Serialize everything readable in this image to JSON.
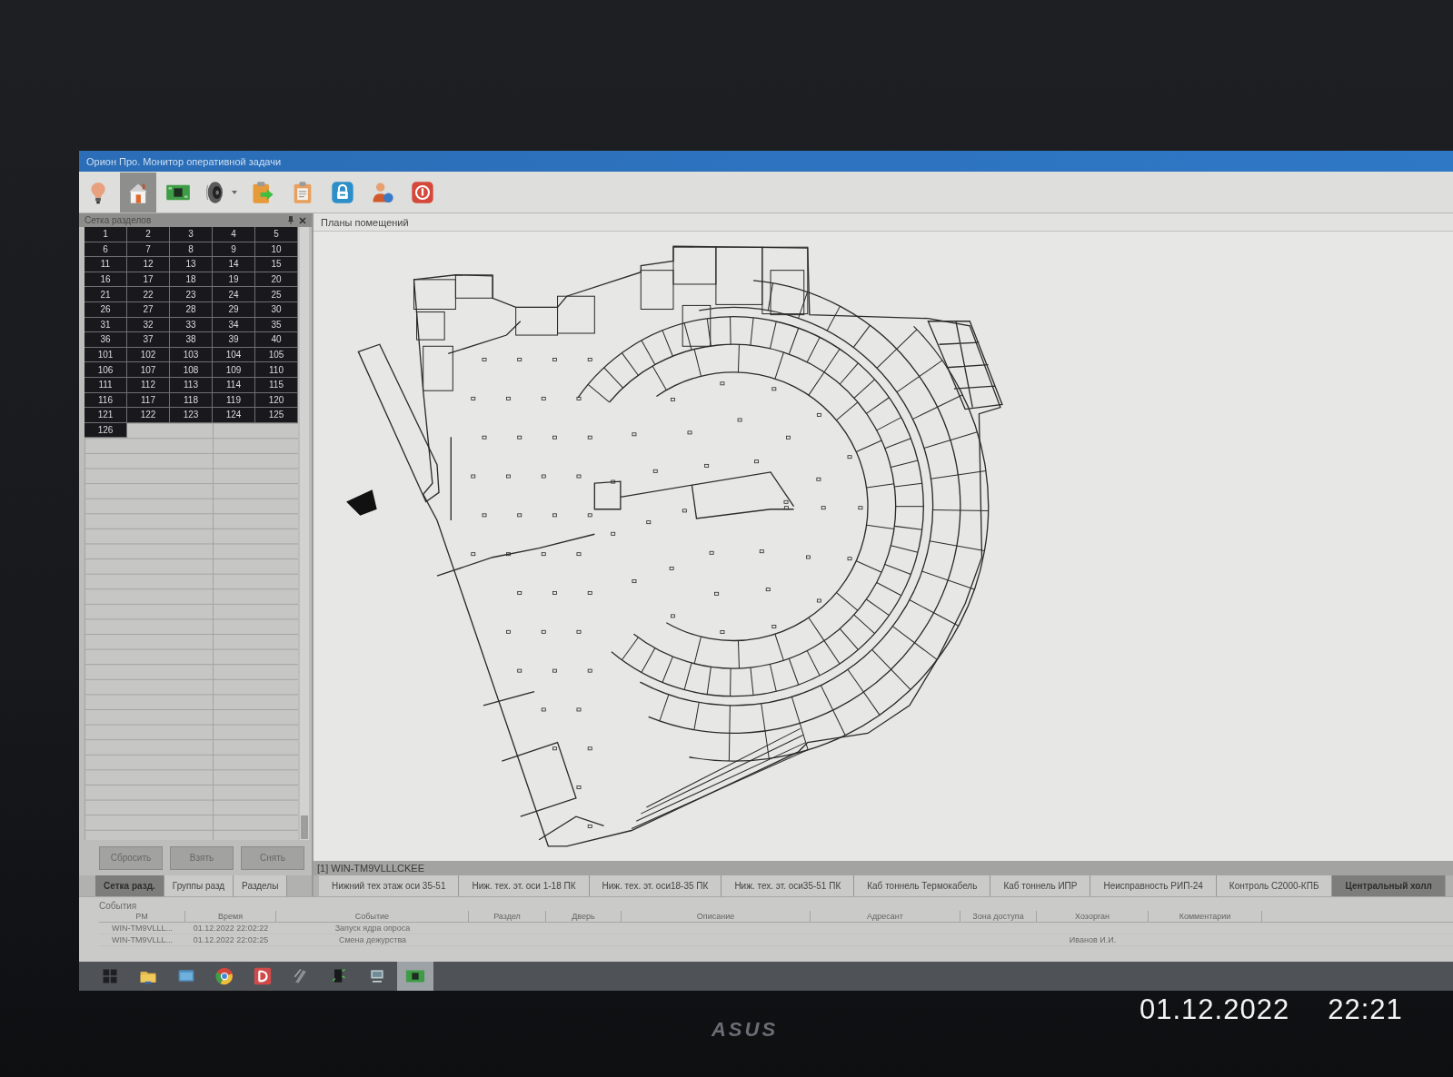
{
  "window": {
    "title": "Орион Про. Монитор оперативной задачи"
  },
  "toolbar": {
    "buttons": [
      {
        "selected": false,
        "dropdown": false
      },
      {
        "selected": true,
        "dropdown": false
      },
      {
        "selected": false,
        "dropdown": false
      },
      {
        "selected": false,
        "dropdown": true
      },
      {
        "selected": false,
        "dropdown": false
      },
      {
        "selected": false,
        "dropdown": false
      },
      {
        "selected": false,
        "dropdown": false
      },
      {
        "selected": false,
        "dropdown": false
      },
      {
        "selected": false,
        "dropdown": false
      }
    ]
  },
  "section_panel": {
    "title": "Сетка разделов",
    "cells": [
      "1",
      "2",
      "3",
      "4",
      "5",
      "6",
      "7",
      "8",
      "9",
      "10",
      "11",
      "12",
      "13",
      "14",
      "15",
      "16",
      "17",
      "18",
      "19",
      "20",
      "21",
      "22",
      "23",
      "24",
      "25",
      "26",
      "27",
      "28",
      "29",
      "30",
      "31",
      "32",
      "33",
      "34",
      "35",
      "36",
      "37",
      "38",
      "39",
      "40",
      "101",
      "102",
      "103",
      "104",
      "105",
      "106",
      "107",
      "108",
      "109",
      "110",
      "111",
      "112",
      "113",
      "114",
      "115",
      "116",
      "117",
      "118",
      "119",
      "120",
      "121",
      "122",
      "123",
      "124",
      "125",
      "126"
    ],
    "buttons": [
      "Сбросить",
      "Взять",
      "Снять"
    ],
    "tabs": [
      {
        "label": "Сетка разд.",
        "selected": true
      },
      {
        "label": "Группы разд",
        "selected": false
      },
      {
        "label": "Разделы",
        "selected": false
      }
    ]
  },
  "plans_panel": {
    "title": "Планы помещений",
    "status": "[1] WIN-TM9VLLLCKEE",
    "tabs": [
      {
        "label": "Нижний тех этаж оси 35-51",
        "selected": false
      },
      {
        "label": "Ниж. тех. эт. оси 1-18 ПК",
        "selected": false
      },
      {
        "label": "Ниж. тех. эт. оси18-35 ПК",
        "selected": false
      },
      {
        "label": "Ниж. тех. эт. оси35-51 ПК",
        "selected": false
      },
      {
        "label": "Каб тоннель Термокабель",
        "selected": false
      },
      {
        "label": "Каб тоннель ИПР",
        "selected": false
      },
      {
        "label": "Неисправность РИП-24",
        "selected": false
      },
      {
        "label": "Контроль С2000-КПБ",
        "selected": false
      },
      {
        "label": "Центральный холл",
        "selected": true
      }
    ]
  },
  "events": {
    "title": "События",
    "columns": [
      "РМ",
      "Время",
      "Событие",
      "Раздел",
      "Дверь",
      "Описание",
      "Адресант",
      "Зона доступа",
      "Хозорган",
      "Комментарии"
    ],
    "rows": [
      {
        "workstation": "WIN-TM9VLLL...",
        "time": "01.12.2022 22:02:22",
        "event": "Запуск ядра опроса"
      },
      {
        "workstation": "WIN-TM9VLLL...",
        "time": "01.12.2022 22:02:25",
        "event": "Смена дежурства",
        "owner": "Иванов И.И."
      }
    ]
  },
  "taskbar": {
    "items": [
      {
        "selected": false
      },
      {
        "selected": false
      },
      {
        "selected": false
      },
      {
        "selected": false
      },
      {
        "selected": false
      },
      {
        "selected": false
      },
      {
        "selected": false
      },
      {
        "selected": false
      },
      {
        "selected": true
      }
    ]
  },
  "monitor": {
    "brand": "ASUS"
  },
  "photo_timestamp": {
    "date": "01.12.2022",
    "time": "22:21"
  }
}
